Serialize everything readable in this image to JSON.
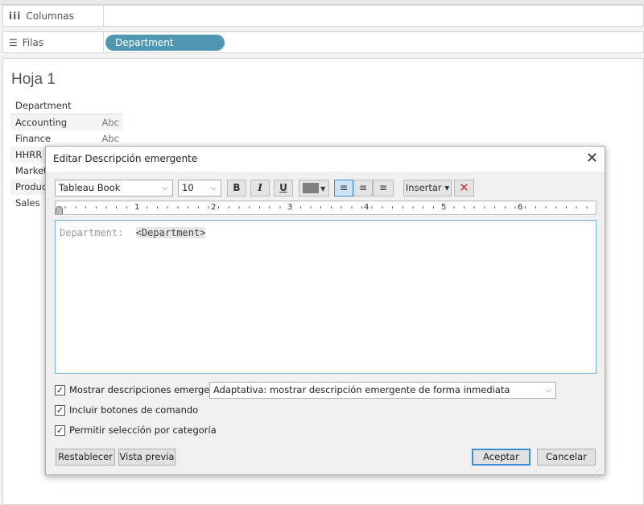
{
  "shelves": {
    "columns_label": "Columnas",
    "rows_label": "Filas",
    "rows_pill": "Department"
  },
  "sheet": {
    "title": "Hoja 1",
    "header": "Department",
    "rows": [
      {
        "name": "Accounting",
        "value": "Abc"
      },
      {
        "name": "Finance",
        "value": "Abc"
      },
      {
        "name": "HHRR",
        "value": ""
      },
      {
        "name": "Marketing",
        "value": ""
      },
      {
        "name": "Production",
        "value": ""
      },
      {
        "name": "Sales",
        "value": ""
      }
    ]
  },
  "dialog": {
    "title": "Editar Descripción emergente",
    "font": "Tableau Book",
    "size": "10",
    "bold": "B",
    "italic": "I",
    "underline": "U",
    "text_color": "#7f7f7f",
    "insert": "Insertar ▾",
    "ruler": [
      "1",
      "2",
      "3",
      "4",
      "5",
      "6"
    ],
    "content_label": "Department:",
    "content_field": "<Department>",
    "show_tooltips": "Mostrar descripciones emergentes",
    "tooltip_mode": "Adaptativa: mostrar descripción emergente de forma inmediata",
    "include_buttons": "Incluir botones de comando",
    "allow_selection": "Permitir selección por categoría",
    "reset": "Restablecer",
    "preview": "Vista previa",
    "ok": "Aceptar",
    "cancel": "Cancelar"
  }
}
